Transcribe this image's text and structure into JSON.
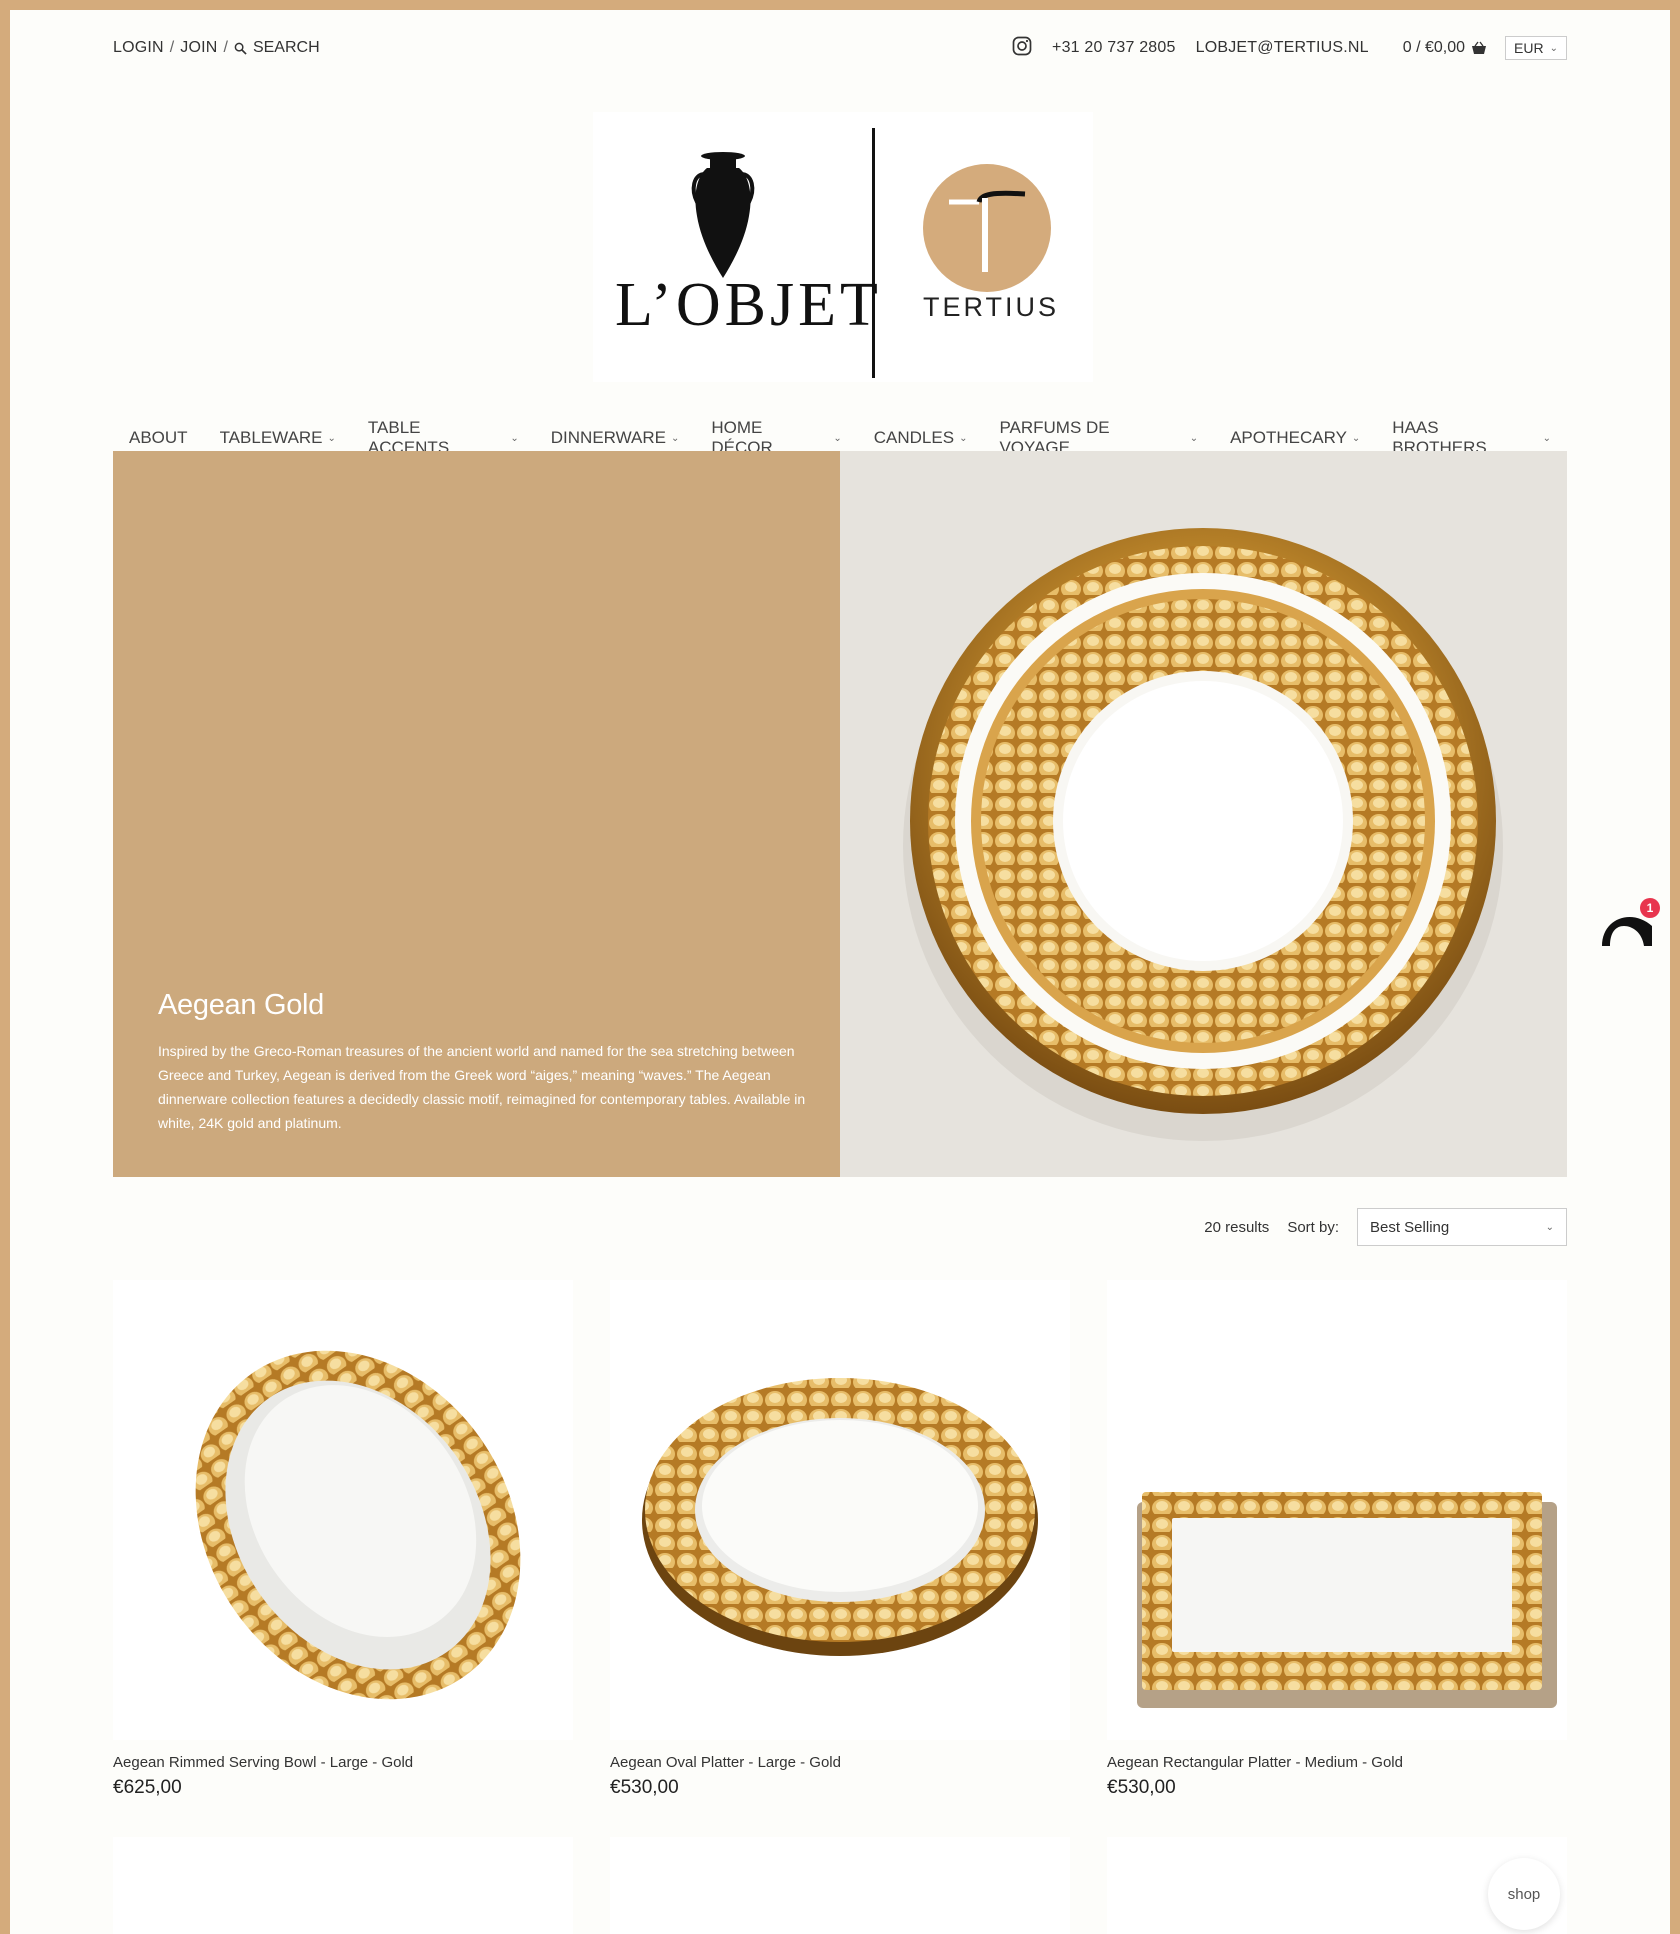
{
  "topbar": {
    "login": "LOGIN",
    "sep1": "/",
    "join": "JOIN",
    "sep2": "/",
    "search": "SEARCH",
    "phone": "+31 20 737 2805",
    "email": "LOBJET@TERTIUS.NL",
    "cart": "0 / €0,00",
    "currency": "EUR"
  },
  "logo": {
    "brand": "L’OBJET",
    "partner": "TERTIUS",
    "accent_color": "#d4ab7c"
  },
  "nav": {
    "items": [
      {
        "label": "ABOUT",
        "dropdown": false
      },
      {
        "label": "TABLEWARE",
        "dropdown": true
      },
      {
        "label": "TABLE ACCENTS",
        "dropdown": true
      },
      {
        "label": "DINNERWARE",
        "dropdown": true
      },
      {
        "label": "HOME DÉCOR",
        "dropdown": true
      },
      {
        "label": "CANDLES",
        "dropdown": true
      },
      {
        "label": "PARFUMS DE VOYAGE",
        "dropdown": true
      },
      {
        "label": "APOTHECARY",
        "dropdown": true
      },
      {
        "label": "HAAS BROTHERS",
        "dropdown": true
      }
    ]
  },
  "hero": {
    "title": "Aegean Gold",
    "description": "Inspired by the Greco-Roman treasures of the ancient world and named for the sea stretching between Greece and Turkey, Aegean is derived from the Greek word “aiges,” meaning “waves.” The Aegean dinnerware collection features a decidedly classic motif, reimagined for contemporary tables. Available in white, 24K gold and platinum.",
    "panel_color": "#cca97d"
  },
  "results": {
    "count": "20 results",
    "sort_label": "Sort by:",
    "sort_value": "Best Selling"
  },
  "products": [
    {
      "title": "Aegean Rimmed Serving Bowl - Large - Gold",
      "price": "€625,00"
    },
    {
      "title": "Aegean Oval Platter - Large - Gold",
      "price": "€530,00"
    },
    {
      "title": "Aegean Rectangular Platter - Medium - Gold",
      "price": "€530,00"
    }
  ],
  "widgets": {
    "notification_count": "1",
    "shop_label": "shop"
  }
}
